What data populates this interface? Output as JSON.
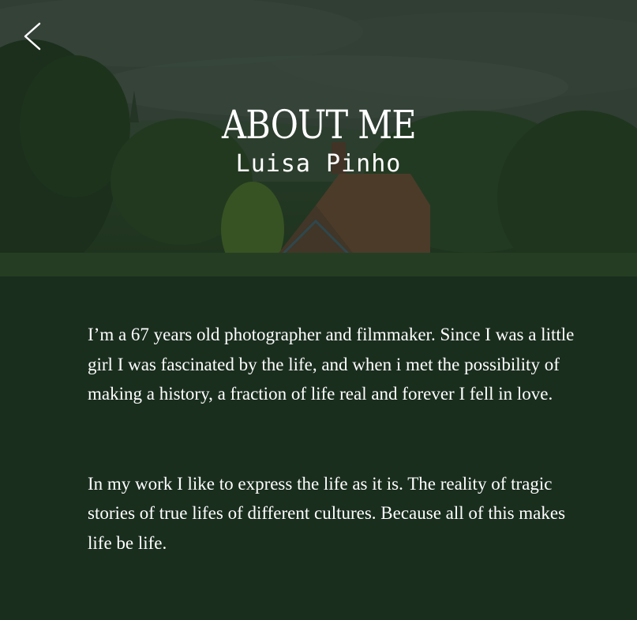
{
  "header": {
    "back_icon": "chevron-left-icon",
    "title": "ABOUT ME",
    "subtitle": "Luisa Pinho"
  },
  "bio": {
    "paragraphs": [
      "I’m a 67 years old photographer and filmmaker. Since I was a little girl I was fascinated by the life, and when i met the possibility of making a history, a fraction of life real and forever I fell in love.",
      "In my work I like to express the life as it is. The reality of tragic stories of true lifes of different cultures. Because all of this makes life be life."
    ]
  },
  "colors": {
    "background": "#1a2e1e",
    "text": "#ffffff"
  }
}
